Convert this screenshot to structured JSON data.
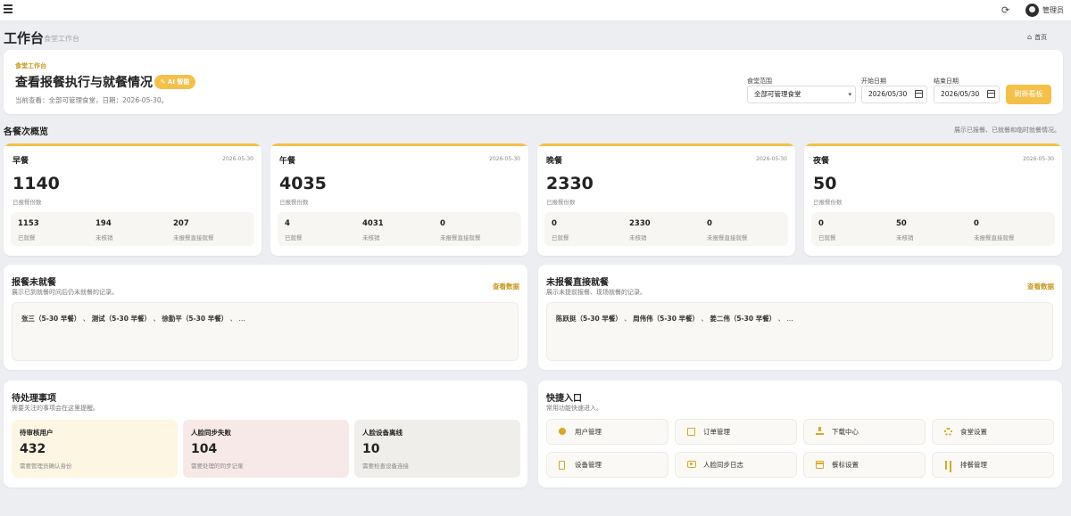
{
  "topbar": {
    "admin_name": "管理员"
  },
  "header": {
    "title": "工作台",
    "subtitle": "食堂工作台",
    "breadcrumb_home": "首页"
  },
  "hero": {
    "kicker": "食堂工作台",
    "title": "查看报餐执行与就餐情况",
    "ai_badge": "AI 智能",
    "note": "当前查看：全部可管理食堂，日期：2026-05-30。",
    "filters": {
      "canteen_label": "食堂范围",
      "canteen_value": "全部可管理食堂",
      "start_label": "开始日期",
      "start_value": "2026/05/30",
      "end_label": "结束日期",
      "end_value": "2026/05/30"
    },
    "refresh_label": "刷新看板"
  },
  "overview": {
    "title": "各餐次概览",
    "desc": "展示已报餐、已就餐和临时就餐情况。",
    "big_label": "已报餐份数",
    "stat_labels": [
      "已就餐",
      "未核销",
      "未报餐直接就餐"
    ],
    "meals": [
      {
        "name": "早餐",
        "date": "2026-05-30",
        "reported": "1140",
        "eaten": "1153",
        "unverified": "194",
        "walkin": "207"
      },
      {
        "name": "午餐",
        "date": "2026-05-30",
        "reported": "4035",
        "eaten": "4",
        "unverified": "4031",
        "walkin": "0"
      },
      {
        "name": "晚餐",
        "date": "2026-05-30",
        "reported": "2330",
        "eaten": "0",
        "unverified": "2330",
        "walkin": "0"
      },
      {
        "name": "夜餐",
        "date": "2026-05-30",
        "reported": "50",
        "eaten": "0",
        "unverified": "50",
        "walkin": "0"
      }
    ]
  },
  "panels": {
    "link_label": "查看数据",
    "noshow": {
      "title": "报餐未就餐",
      "desc": "展示已到就餐时间后仍未就餐的记录。",
      "names": [
        "张三（5-30 早餐）",
        "测试（5-30 早餐）",
        "徐勤平（5-30 早餐）"
      ],
      "more": "..."
    },
    "walkin": {
      "title": "未报餐直接就餐",
      "desc": "展示未提前报餐、现场就餐的记录。",
      "names": [
        "陈跃挺（5-30 早餐）",
        "周伟伟（5-30 早餐）",
        "姜二伟（5-30 早餐）"
      ],
      "more": "..."
    }
  },
  "todo": {
    "title": "待处理事项",
    "desc": "需要关注的事项会在这里提醒。",
    "items": [
      {
        "title": "待审核用户",
        "count": "432",
        "desc": "需要管理员确认身份",
        "bg": "#fdf6e3"
      },
      {
        "title": "人脸同步失败",
        "count": "104",
        "desc": "需要处理的同步记录",
        "bg": "#f7e9e7"
      },
      {
        "title": "人脸设备离线",
        "count": "10",
        "desc": "需要检查设备连接",
        "bg": "#efeeeb"
      }
    ]
  },
  "quick": {
    "title": "快捷入口",
    "desc": "常用功能快速进入。",
    "items": [
      {
        "label": "用户管理",
        "icon": "user-icon"
      },
      {
        "label": "订单管理",
        "icon": "order-icon"
      },
      {
        "label": "下载中心",
        "icon": "download-icon"
      },
      {
        "label": "食堂设置",
        "icon": "gear-icon"
      },
      {
        "label": "设备管理",
        "icon": "device-icon"
      },
      {
        "label": "人脸同步日志",
        "icon": "face-icon"
      },
      {
        "label": "餐标设置",
        "icon": "calendar-icon"
      },
      {
        "label": "排餐管理",
        "icon": "fork-icon"
      }
    ]
  },
  "colors": {
    "accent": "#f3c04a",
    "accent_text": "#c9951c",
    "background": "#eceef2"
  }
}
